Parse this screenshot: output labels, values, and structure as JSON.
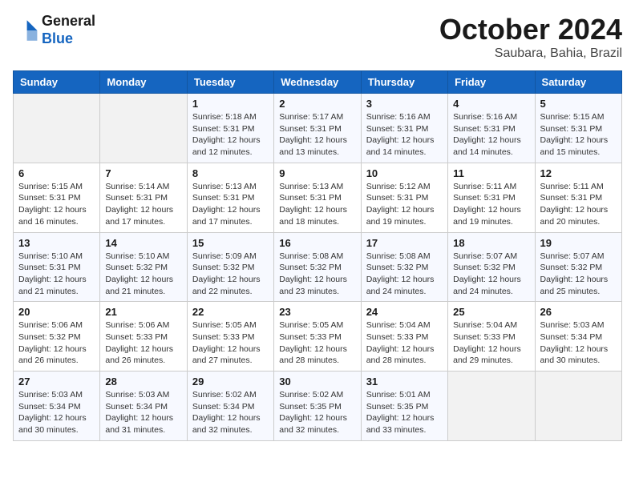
{
  "header": {
    "logo_line1": "General",
    "logo_line2": "Blue",
    "month": "October 2024",
    "location": "Saubara, Bahia, Brazil"
  },
  "weekdays": [
    "Sunday",
    "Monday",
    "Tuesday",
    "Wednesday",
    "Thursday",
    "Friday",
    "Saturday"
  ],
  "weeks": [
    [
      {
        "day": "",
        "info": ""
      },
      {
        "day": "",
        "info": ""
      },
      {
        "day": "1",
        "info": "Sunrise: 5:18 AM\nSunset: 5:31 PM\nDaylight: 12 hours\nand 12 minutes."
      },
      {
        "day": "2",
        "info": "Sunrise: 5:17 AM\nSunset: 5:31 PM\nDaylight: 12 hours\nand 13 minutes."
      },
      {
        "day": "3",
        "info": "Sunrise: 5:16 AM\nSunset: 5:31 PM\nDaylight: 12 hours\nand 14 minutes."
      },
      {
        "day": "4",
        "info": "Sunrise: 5:16 AM\nSunset: 5:31 PM\nDaylight: 12 hours\nand 14 minutes."
      },
      {
        "day": "5",
        "info": "Sunrise: 5:15 AM\nSunset: 5:31 PM\nDaylight: 12 hours\nand 15 minutes."
      }
    ],
    [
      {
        "day": "6",
        "info": "Sunrise: 5:15 AM\nSunset: 5:31 PM\nDaylight: 12 hours\nand 16 minutes."
      },
      {
        "day": "7",
        "info": "Sunrise: 5:14 AM\nSunset: 5:31 PM\nDaylight: 12 hours\nand 17 minutes."
      },
      {
        "day": "8",
        "info": "Sunrise: 5:13 AM\nSunset: 5:31 PM\nDaylight: 12 hours\nand 17 minutes."
      },
      {
        "day": "9",
        "info": "Sunrise: 5:13 AM\nSunset: 5:31 PM\nDaylight: 12 hours\nand 18 minutes."
      },
      {
        "day": "10",
        "info": "Sunrise: 5:12 AM\nSunset: 5:31 PM\nDaylight: 12 hours\nand 19 minutes."
      },
      {
        "day": "11",
        "info": "Sunrise: 5:11 AM\nSunset: 5:31 PM\nDaylight: 12 hours\nand 19 minutes."
      },
      {
        "day": "12",
        "info": "Sunrise: 5:11 AM\nSunset: 5:31 PM\nDaylight: 12 hours\nand 20 minutes."
      }
    ],
    [
      {
        "day": "13",
        "info": "Sunrise: 5:10 AM\nSunset: 5:31 PM\nDaylight: 12 hours\nand 21 minutes."
      },
      {
        "day": "14",
        "info": "Sunrise: 5:10 AM\nSunset: 5:32 PM\nDaylight: 12 hours\nand 21 minutes."
      },
      {
        "day": "15",
        "info": "Sunrise: 5:09 AM\nSunset: 5:32 PM\nDaylight: 12 hours\nand 22 minutes."
      },
      {
        "day": "16",
        "info": "Sunrise: 5:08 AM\nSunset: 5:32 PM\nDaylight: 12 hours\nand 23 minutes."
      },
      {
        "day": "17",
        "info": "Sunrise: 5:08 AM\nSunset: 5:32 PM\nDaylight: 12 hours\nand 24 minutes."
      },
      {
        "day": "18",
        "info": "Sunrise: 5:07 AM\nSunset: 5:32 PM\nDaylight: 12 hours\nand 24 minutes."
      },
      {
        "day": "19",
        "info": "Sunrise: 5:07 AM\nSunset: 5:32 PM\nDaylight: 12 hours\nand 25 minutes."
      }
    ],
    [
      {
        "day": "20",
        "info": "Sunrise: 5:06 AM\nSunset: 5:32 PM\nDaylight: 12 hours\nand 26 minutes."
      },
      {
        "day": "21",
        "info": "Sunrise: 5:06 AM\nSunset: 5:33 PM\nDaylight: 12 hours\nand 26 minutes."
      },
      {
        "day": "22",
        "info": "Sunrise: 5:05 AM\nSunset: 5:33 PM\nDaylight: 12 hours\nand 27 minutes."
      },
      {
        "day": "23",
        "info": "Sunrise: 5:05 AM\nSunset: 5:33 PM\nDaylight: 12 hours\nand 28 minutes."
      },
      {
        "day": "24",
        "info": "Sunrise: 5:04 AM\nSunset: 5:33 PM\nDaylight: 12 hours\nand 28 minutes."
      },
      {
        "day": "25",
        "info": "Sunrise: 5:04 AM\nSunset: 5:33 PM\nDaylight: 12 hours\nand 29 minutes."
      },
      {
        "day": "26",
        "info": "Sunrise: 5:03 AM\nSunset: 5:34 PM\nDaylight: 12 hours\nand 30 minutes."
      }
    ],
    [
      {
        "day": "27",
        "info": "Sunrise: 5:03 AM\nSunset: 5:34 PM\nDaylight: 12 hours\nand 30 minutes."
      },
      {
        "day": "28",
        "info": "Sunrise: 5:03 AM\nSunset: 5:34 PM\nDaylight: 12 hours\nand 31 minutes."
      },
      {
        "day": "29",
        "info": "Sunrise: 5:02 AM\nSunset: 5:34 PM\nDaylight: 12 hours\nand 32 minutes."
      },
      {
        "day": "30",
        "info": "Sunrise: 5:02 AM\nSunset: 5:35 PM\nDaylight: 12 hours\nand 32 minutes."
      },
      {
        "day": "31",
        "info": "Sunrise: 5:01 AM\nSunset: 5:35 PM\nDaylight: 12 hours\nand 33 minutes."
      },
      {
        "day": "",
        "info": ""
      },
      {
        "day": "",
        "info": ""
      }
    ]
  ]
}
